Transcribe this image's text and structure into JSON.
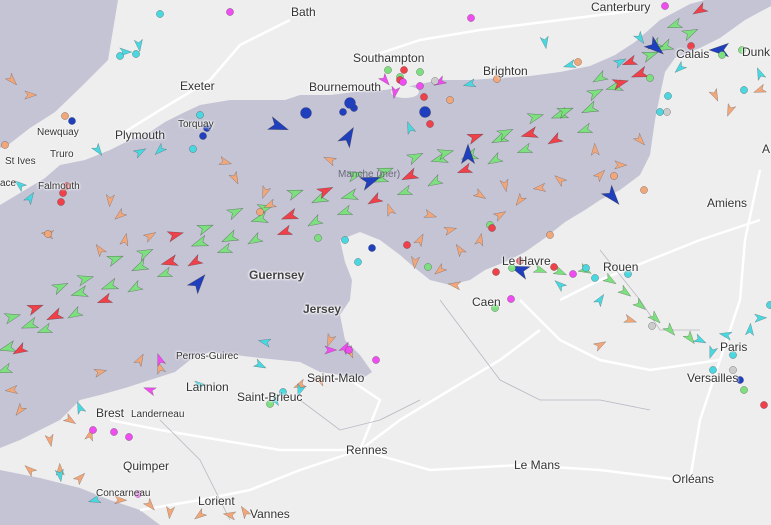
{
  "map": {
    "colors": {
      "land": "#eeeeee",
      "sea": "#c5c4d5",
      "road": "#ffffff",
      "border": "#b8b8c4",
      "cargo": "#7de07f",
      "tanker": "#f0404a",
      "passenger": "#1f3fbf",
      "tug_special": "#49d7e0",
      "fishing": "#f2a77a",
      "pleasure": "#f04df0",
      "unknown": "#cccccc"
    },
    "places": {
      "bath": "Bath",
      "canterbury": "Canterbury",
      "dunkirk": "Dunk",
      "exeter": "Exeter",
      "southampton": "Southampton",
      "bournemouth": "Bournemouth",
      "brighton": "Brighton",
      "torquay": "Torquay",
      "newquay": "Newquay",
      "plymouth": "Plymouth",
      "truro": "Truro",
      "st_ives": "St Ives",
      "falmouth": "Falmouth",
      "penzance": "ace",
      "calais": "Calais",
      "manche": "Manche (mer)",
      "amiens": "Amiens",
      "guernsey": "Guernsey",
      "jersey": "Jersey",
      "le_havre": "Le Havre",
      "rouen": "Rouen",
      "caen": "Caen",
      "perros_guirec": "Perros-Guirec",
      "lannion": "Lannion",
      "saint_malo": "Saint-Malo",
      "saint_brieuc": "Saint-Brieuc",
      "brest": "Brest",
      "landerneau": "Landerneau",
      "paris": "Paris",
      "versailles": "Versailles",
      "quimper": "Quimper",
      "concarneau": "Concarneau",
      "rennes": "Rennes",
      "le_mans": "Le Mans",
      "lorient": "Lorient",
      "vannes": "Vannes",
      "orleans": "Orléans",
      "arras": "A"
    }
  }
}
